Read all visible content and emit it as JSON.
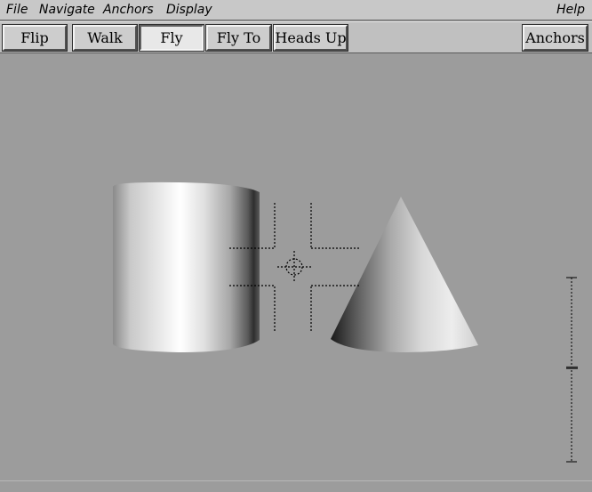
{
  "menubar": {
    "file": "File",
    "navigate": "Navigate",
    "anchors": "Anchors",
    "display": "Display",
    "help": "Help"
  },
  "toolbar": {
    "flip": "Flip",
    "walk": "Walk",
    "fly": "Fly",
    "fly_to": "Fly To",
    "heads_up": "Heads Up",
    "anchors": "Anchors",
    "active_mode": "Fly"
  },
  "scene": {
    "objects": [
      "cylinder",
      "cone"
    ],
    "background": "#9c9c9c",
    "altitude_level": 0.51
  },
  "icons": {
    "crosshair": "crosshair-icon",
    "altitude": "altitude-slider-icon"
  }
}
